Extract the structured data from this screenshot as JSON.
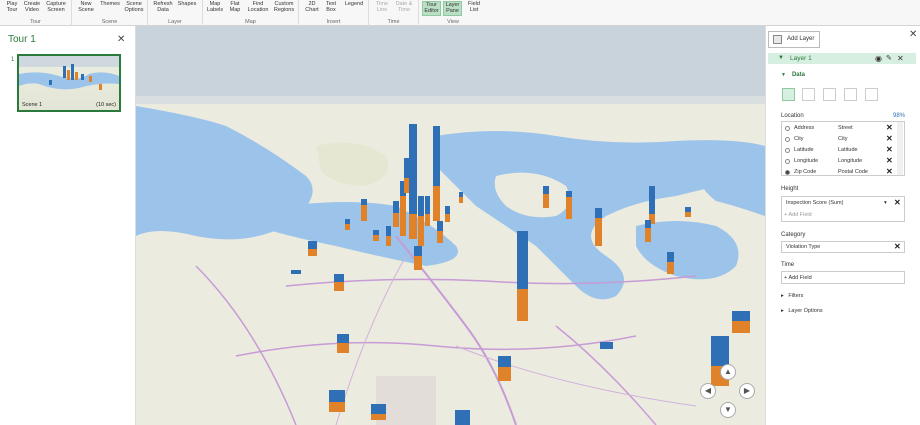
{
  "ribbon": {
    "groups": [
      {
        "label": "Tour",
        "buttons": [
          "Play\nTour",
          "Create\nVideo",
          "Capture\nScreen"
        ]
      },
      {
        "label": "Scene",
        "buttons": [
          "New\nScene",
          "Themes",
          "Scene\nOptions"
        ]
      },
      {
        "label": "Layer",
        "buttons": [
          "Refresh\nData",
          "Shapes"
        ]
      },
      {
        "label": "Map",
        "buttons": [
          "Map\nLabels",
          "Flat\nMap",
          "Find\nLocation",
          "Custom\nRegions"
        ]
      },
      {
        "label": "Insert",
        "buttons": [
          "2D\nChart",
          "Text\nBox",
          "Legend"
        ]
      },
      {
        "label": "Time",
        "buttons": [
          "Time\nLine",
          "Date &\nTime"
        ]
      },
      {
        "label": "View",
        "buttons": [
          "Tour\nEditor",
          "Layer\nPane",
          "Field\nList"
        ]
      }
    ]
  },
  "tour": {
    "title": "Tour 1",
    "scene_number": "1",
    "scene_name": "Scene 1",
    "scene_duration": "(10 sec)"
  },
  "layer_pane": {
    "add_layer": "Add Layer",
    "layer_name": "Layer 1",
    "data_heading": "Data",
    "location_label": "Location",
    "location_percent": "98%",
    "location_rows": [
      {
        "field": "Address",
        "type": "Street"
      },
      {
        "field": "City",
        "type": "City"
      },
      {
        "field": "Latitude",
        "type": "Latitude"
      },
      {
        "field": "Longitude",
        "type": "Longitude"
      },
      {
        "field": "Zip Code",
        "type": "Postal Code"
      }
    ],
    "height_label": "Height",
    "height_field": "Inspection Score (Sum)",
    "add_field": "Add Field",
    "category_label": "Category",
    "category_field": "Violation Type",
    "time_label": "Time",
    "time_add_field": "Add Field",
    "filters": "Filters",
    "layer_options": "Layer Options"
  },
  "colors": {
    "accent": "#2b7a3d",
    "bar_blue": "#2e6fb6",
    "bar_orange": "#e0822a",
    "water": "#9cc3ea"
  }
}
